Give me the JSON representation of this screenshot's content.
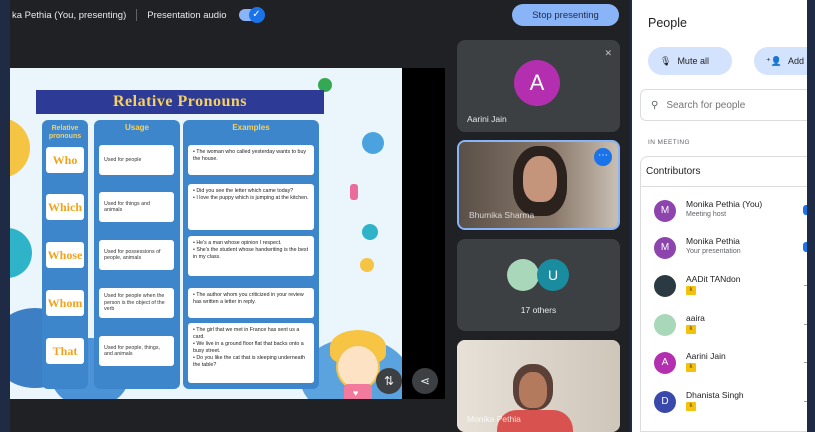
{
  "topbar": {
    "presenter_label": "ka Pethia (You, presenting)",
    "audio_label": "Presentation audio",
    "audio_on": true,
    "stop_label": "Stop presenting"
  },
  "slide": {
    "title": "Relative Pronouns",
    "headers": {
      "pronouns": "Relative pronouns",
      "usage": "Usage",
      "examples": "Examples"
    },
    "rows": [
      {
        "pronoun": "Who",
        "usage": "Used for people",
        "examples": [
          "• The woman who called yesterday wants to buy the house."
        ]
      },
      {
        "pronoun": "Which",
        "usage": "Used for things and animals",
        "examples": [
          "• Did you see the letter which came today?",
          "• I love the puppy which is jumping at the kitchen."
        ]
      },
      {
        "pronoun": "Whose",
        "usage": "Used for possessions of people, animals",
        "examples": [
          "• He's a man whose opinion I respect.",
          "• She's the student whose handwriting is the best in my class."
        ]
      },
      {
        "pronoun": "Whom",
        "usage": "Used for people when the person is the object of the verb",
        "examples": [
          "• The author whom you criticized in your review has written a letter in reply."
        ]
      },
      {
        "pronoun": "That",
        "usage": "Used for people, things, and animals",
        "examples": [
          "• The girl that we met in France has sent us a card.",
          "• We live in a ground floor flat that backs onto a busy street.",
          "• Do you like the cat that is sleeping underneath the table?"
        ]
      }
    ]
  },
  "tiles": {
    "aarini": {
      "initial": "A",
      "name": "Aarini Jain"
    },
    "video1": {
      "name": "Bhumika Sharma"
    },
    "others": {
      "initial": "U",
      "label": "17 others"
    },
    "video2": {
      "name": "Monika Pethia"
    }
  },
  "panel": {
    "title": "People",
    "mute_all": "Mute all",
    "add": "Add",
    "search_placeholder": "Search for people",
    "section_label": "IN MEETING",
    "contributors_label": "Contributors",
    "people": [
      {
        "name": "Monika Pethia (You)",
        "sub": "Meeting host",
        "initial": "M",
        "color": "#8e44ad"
      },
      {
        "name": "Monika Pethia",
        "sub": "Your presentation",
        "initial": "M",
        "color": "#8e44ad"
      },
      {
        "name": "AADit TANdon",
        "initial": "",
        "color": "#2b3a42"
      },
      {
        "name": "aaira",
        "initial": "",
        "color": "#a8d8b9"
      },
      {
        "name": "Aarini Jain",
        "initial": "A",
        "color": "#b32fb0"
      },
      {
        "name": "Dhanista Singh",
        "initial": "D",
        "color": "#3949ab"
      }
    ]
  }
}
